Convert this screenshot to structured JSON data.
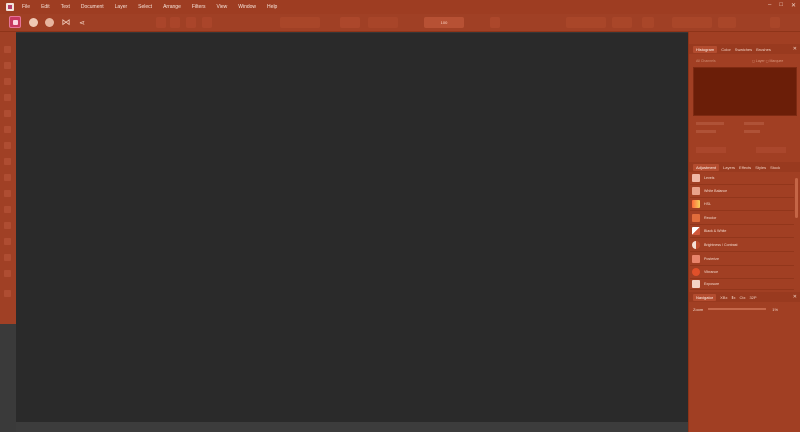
{
  "menubar": {
    "items": [
      "File",
      "Edit",
      "Text",
      "Document",
      "Layer",
      "Select",
      "Arrange",
      "Filters",
      "View",
      "Window",
      "Help"
    ],
    "window_controls": [
      "–",
      "□",
      "✕"
    ]
  },
  "toolbar": {
    "personas": [
      "photo-persona",
      "liquify-persona",
      "develop-persona",
      "tone-mapping-persona",
      "export-persona"
    ],
    "doc_value": "100"
  },
  "panels": {
    "histogram": {
      "tabs": [
        "Histogram",
        "Color",
        "Swatches",
        "Brushes"
      ],
      "active_tab": "Histogram",
      "channel": "All Channels",
      "options": [
        "Layer",
        "Marquee"
      ]
    },
    "adjustment": {
      "tabs": [
        "Adjustment",
        "Layers",
        "Effects",
        "Styles",
        "Stock"
      ],
      "active_tab": "Adjustment",
      "items": [
        {
          "label": "Levels",
          "color": "#f0b8a6"
        },
        {
          "label": "White Balance",
          "color": "#e9a28b"
        },
        {
          "label": "HSL",
          "color": "#d95c3b"
        },
        {
          "label": "Recolor",
          "color": "#e06c3b"
        },
        {
          "label": "Black & White",
          "color": "#ffffff"
        },
        {
          "label": "Brightness / Contrast",
          "color": "#f5e0d6"
        },
        {
          "label": "Posterize",
          "color": "#e8836a"
        },
        {
          "label": "Vibrance",
          "color": "#e0502a"
        },
        {
          "label": "Exposure",
          "color": "#f4d2c4"
        }
      ]
    },
    "navigator": {
      "tabs": [
        "Navigator",
        "XBx",
        "Ⅱx",
        "Ctx",
        "32P"
      ],
      "active_tab": "Navigator",
      "zoom_label": "Zoom",
      "zoom_value": "1%"
    }
  },
  "colors": {
    "chrome": "#a13f23",
    "canvas": "#2a2a2a",
    "histogram_bg": "#6b1e08"
  }
}
